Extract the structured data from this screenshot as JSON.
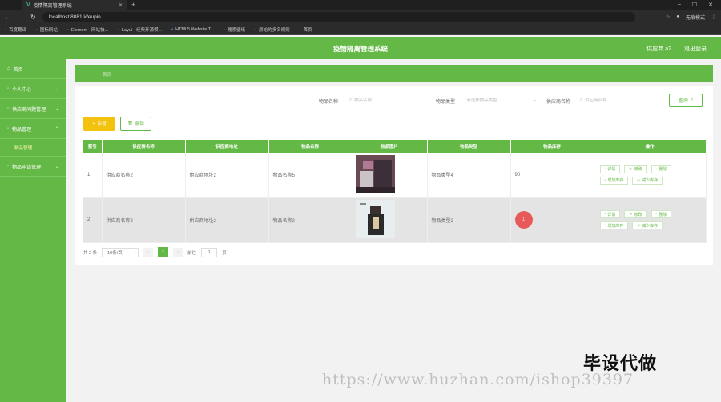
{
  "browser": {
    "tab_title": "疫情隔离管理系统",
    "url": "localhost:8081/#/eupin",
    "profile": "无痕模式",
    "bookmarks": [
      "百度翻译",
      "图标网站",
      "Element - 网站快...",
      "Layui - 经典开源模...",
      "HTML5 Website T...",
      "搜索壁纸",
      "原始的多名规则",
      "首页"
    ]
  },
  "header": {
    "title": "疫情隔离管理系统",
    "user": "供应商 a2",
    "logout": "退出登录"
  },
  "sidebar": {
    "items": [
      {
        "label": "首页"
      },
      {
        "label": "个人中心"
      },
      {
        "label": "供应商问题管理"
      },
      {
        "label": "物品管理"
      },
      {
        "label": "物品申请管理"
      }
    ],
    "active_sub": "物品管理"
  },
  "breadcrumb": "首页",
  "search": {
    "name_label": "物品名称",
    "name_placeholder": "物品名称",
    "type_label": "物品类型",
    "type_placeholder": "请选择物品类型",
    "supplier_label": "供应商名称",
    "supplier_placeholder": "供应商名称",
    "query": "查询"
  },
  "actions": {
    "add": "新增",
    "delete": "删除"
  },
  "table": {
    "headers": [
      "索引",
      "供应商名称",
      "供应商地址",
      "物品名称",
      "物品图片",
      "物品类型",
      "物品库存",
      "操作"
    ],
    "rows": [
      {
        "index": "1",
        "supplier": "供应商名称2",
        "address": "供应商地址2",
        "name": "物品名称5",
        "type": "物品类型4",
        "stock": "90"
      },
      {
        "index": "2",
        "supplier": "供应商名称2",
        "address": "供应商地址2",
        "name": "物品名称2",
        "type": "物品类型2",
        "stock": "1"
      }
    ],
    "ops": [
      "详情",
      "修改",
      "删除",
      "增加库存",
      "减少库存"
    ]
  },
  "pager": {
    "total": "共 2 条",
    "size": "10条/页",
    "current": "1",
    "goto": "前往",
    "goto_value": "1",
    "page_unit": "页"
  },
  "watermark": {
    "cn": "毕设代做",
    "url": "https://www.huzhan.com/ishop39397"
  },
  "colors": {
    "primary": "#64b845",
    "warning": "#f2c20f"
  }
}
